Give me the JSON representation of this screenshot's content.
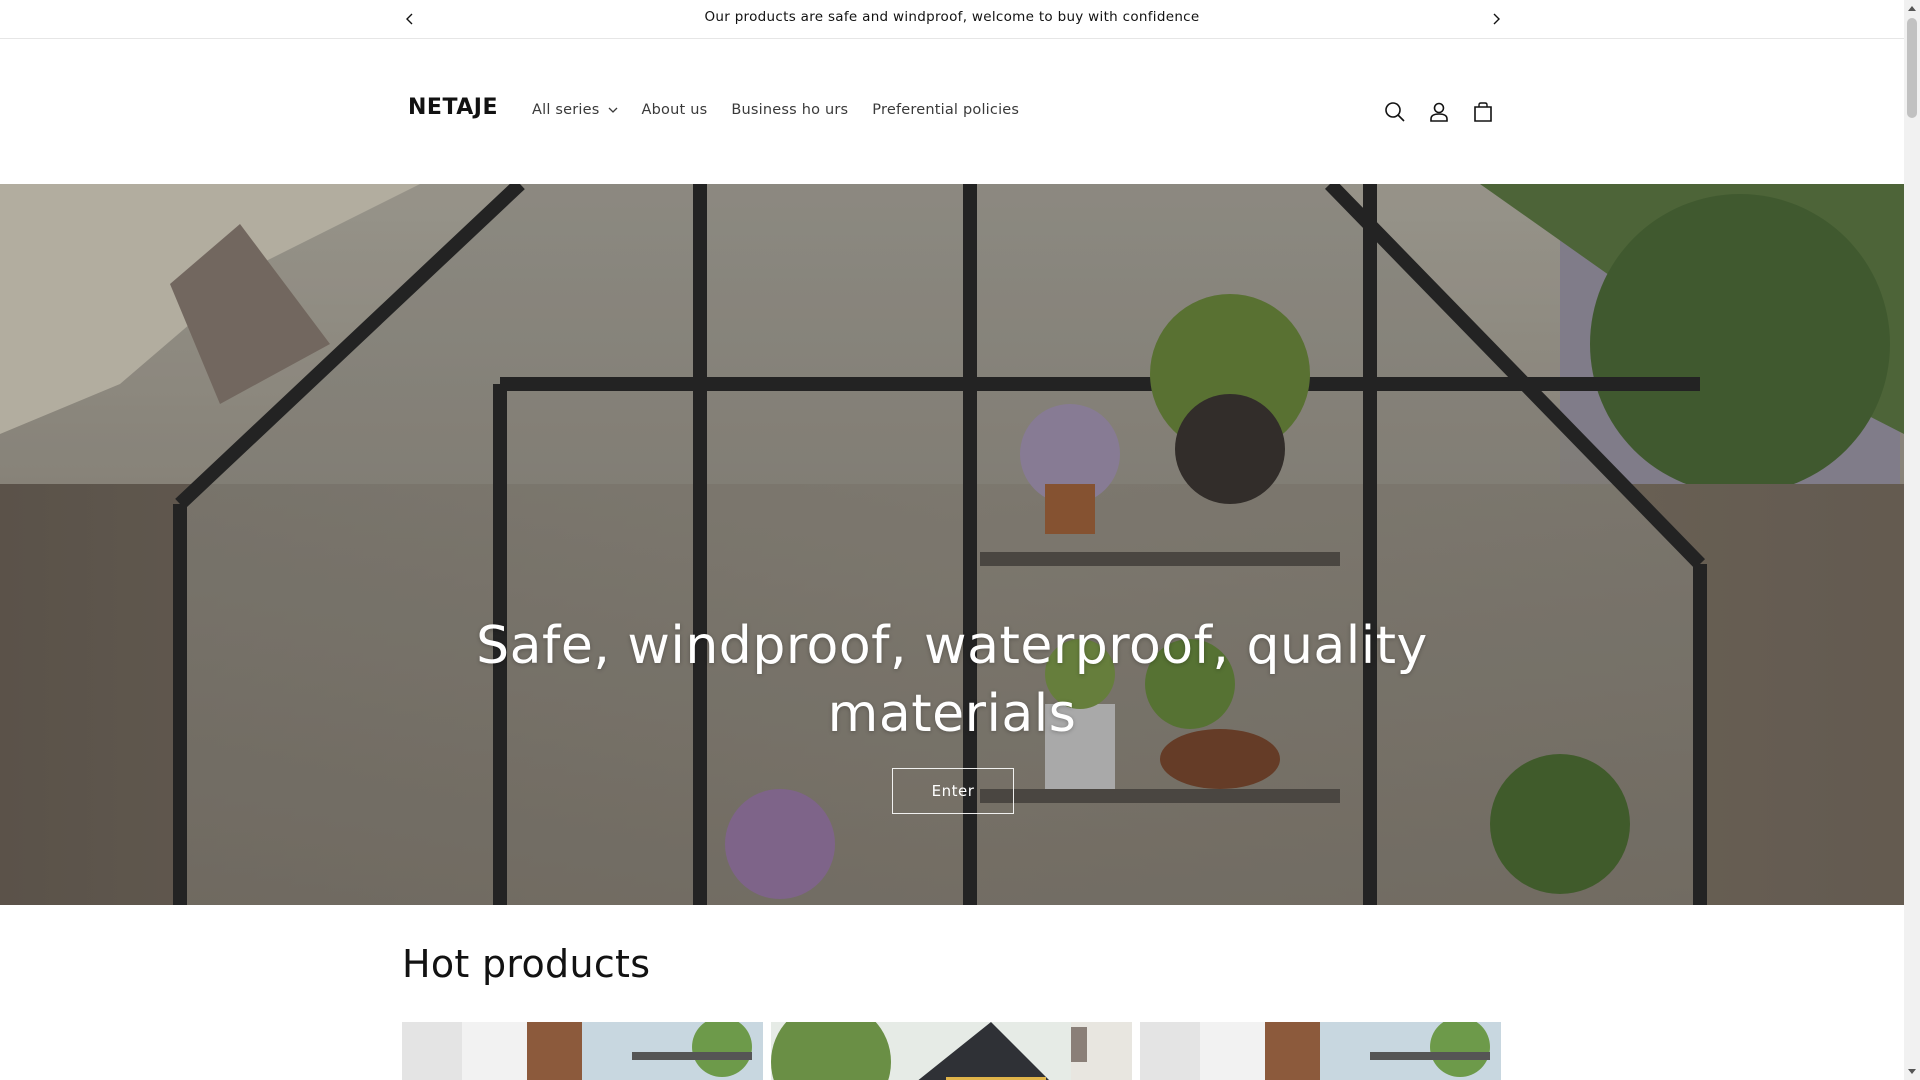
{
  "announcement": {
    "message": "Our products are safe and windproof, welcome to buy with confidence",
    "prev_icon": "chevron-left-icon",
    "next_icon": "chevron-right-icon"
  },
  "header": {
    "logo": "NETAJE",
    "nav": [
      {
        "label": "All series",
        "has_dropdown": true
      },
      {
        "label": "About us"
      },
      {
        "label": "Business ho urs"
      },
      {
        "label": "Preferential policies"
      }
    ],
    "icons": [
      "search-icon",
      "account-icon",
      "cart-icon"
    ]
  },
  "hero": {
    "title_line1": "Safe, windproof, waterproof, quality",
    "title_line2": "materials",
    "button_label": "Enter"
  },
  "hot_products": {
    "title": "Hot products"
  },
  "colors": {
    "text": "#121212",
    "background": "#ffffff",
    "border": "#e6e6e6"
  }
}
